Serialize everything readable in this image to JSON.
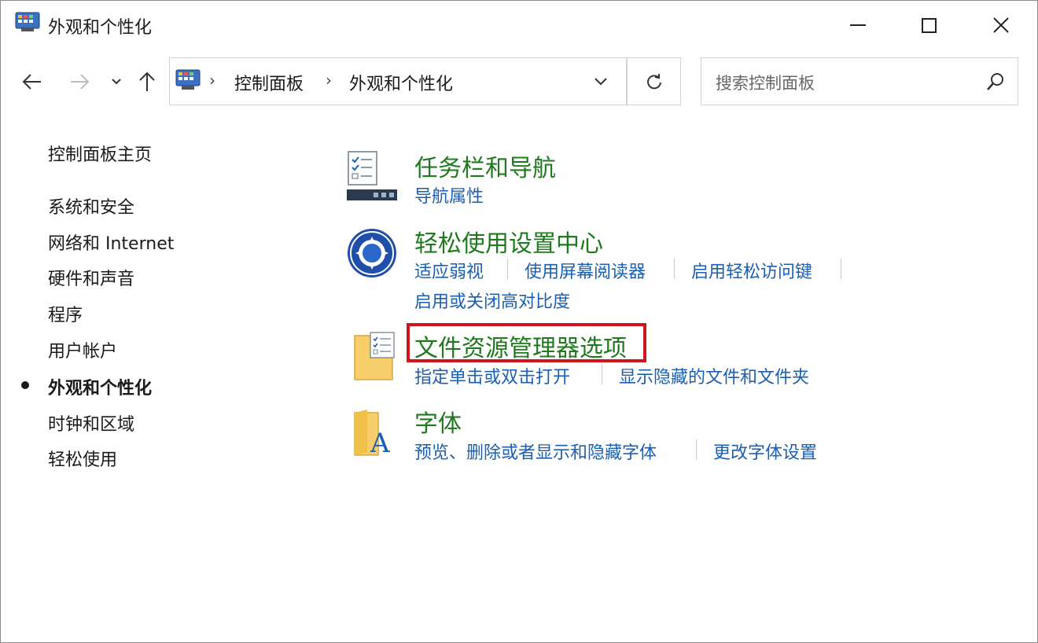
{
  "window": {
    "title": "外观和个性化",
    "app_icon": "control-panel-icon",
    "buttons": {
      "minimize": "minimize-icon",
      "maximize": "maximize-icon",
      "close": "close-icon"
    }
  },
  "navigation": {
    "back_icon": "back-arrow-icon",
    "forward_icon": "forward-arrow-icon",
    "recent_icon": "chevron-down-icon",
    "up_icon": "up-arrow-icon",
    "address": {
      "icon": "control-panel-icon",
      "breadcrumbs": [
        "控制面板",
        "外观和个性化"
      ],
      "separator": "›"
    },
    "refresh_icon": "refresh-icon",
    "search": {
      "placeholder": "搜索控制面板",
      "icon": "search-icon"
    }
  },
  "sidebar": {
    "home": "控制面板主页",
    "items": [
      {
        "label": "系统和安全",
        "active": false
      },
      {
        "label": "网络和 Internet",
        "active": false
      },
      {
        "label": "硬件和声音",
        "active": false
      },
      {
        "label": "程序",
        "active": false
      },
      {
        "label": "用户帐户",
        "active": false
      },
      {
        "label": "外观和个性化",
        "active": true
      },
      {
        "label": "时钟和区域",
        "active": false
      },
      {
        "label": "轻松使用",
        "active": false
      }
    ]
  },
  "categories": [
    {
      "title": "任务栏和导航",
      "icon": "taskbar-icon",
      "links": [
        "导航属性"
      ]
    },
    {
      "title": "轻松使用设置中心",
      "icon": "ease-of-access-icon",
      "links": [
        "适应弱视",
        "使用屏幕阅读器",
        "启用轻松访问键",
        "启用或关闭高对比度"
      ]
    },
    {
      "title": "文件资源管理器选项",
      "icon": "folder-options-icon",
      "highlighted": true,
      "links": [
        "指定单击或双击打开",
        "显示隐藏的文件和文件夹"
      ]
    },
    {
      "title": "字体",
      "icon": "fonts-folder-icon",
      "links": [
        "预览、删除或者显示和隐藏字体",
        "更改字体设置"
      ]
    }
  ],
  "colors": {
    "category_title": "#1f7a1f",
    "link": "#1a5fb4",
    "highlight_border": "#d0141d",
    "window_border": "#8c8c8c"
  }
}
